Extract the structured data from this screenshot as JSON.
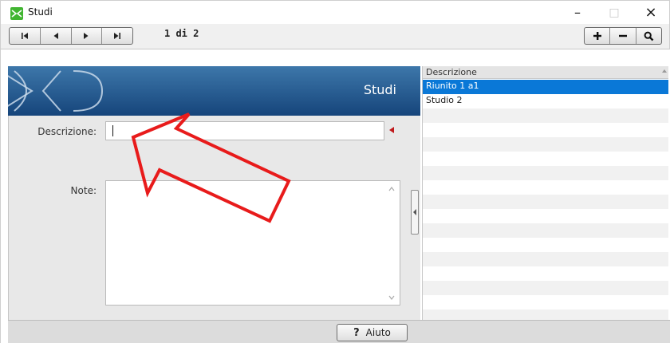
{
  "window": {
    "title": "Studi",
    "minimize": "–",
    "maximize": "□",
    "close": "×"
  },
  "toolbar": {
    "record_counter": "1 di 2"
  },
  "banner": {
    "title": "Studi"
  },
  "form": {
    "description_label": "Descrizione:",
    "description_value": "",
    "note_label": "Note:",
    "note_value": ""
  },
  "grid": {
    "header": "Descrizione",
    "rows": [
      "Riunito 1 a1",
      "Studio 2"
    ],
    "selected_index": 0
  },
  "footer": {
    "help_symbol": "?",
    "help_label": "Aiuto"
  },
  "colors": {
    "banner": "#16457b",
    "selection": "#0a78d7",
    "arrow": "#e81b1b",
    "required": "#c0191b"
  }
}
